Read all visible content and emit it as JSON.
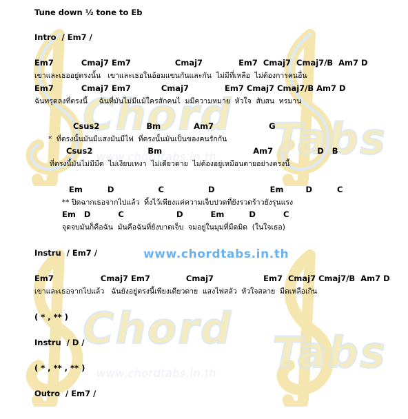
{
  "watermark": {
    "words": [
      "Chord",
      "Tabs",
      "Chord",
      "Tabs"
    ],
    "url": "www.chordtabs.in.th",
    "clef_icon": "treble-clef-icon"
  },
  "site_url": "www.chordtabs.in.th",
  "sheet": {
    "tuning": "Tune down ½ tone to Eb",
    "intro": "Intro  / Em7 /",
    "v1_chords_a": "Em7          Cmaj7 Em7                Cmaj7             Em7  Cmaj7  Cmaj7/B  Am7 D",
    "v1_lyrics_a": "เขาและเธออยู่ตรงนั้น   เขาและเธอในอ้อมแขนกันและกัน  ไม่มีที่เหลือ  ไม่ต้องการคนอื่น",
    "v1_chords_b": "Em7          Cmaj7 Em7           Cmaj7             Em7 Cmaj7 Cmaj7/B Am7 D",
    "v1_lyrics_b": "ฉันทรุดลงที่ตรงนี้     ฉันที่มันไม่มีแม้ใครสักคนไ  มมีความหมาย  หัวใจ  สับสน  ทรมาน",
    "pre_chords_a": "Csus2                 Bm            Am7                    G",
    "pre_lyrics_a": "*  ที่ตรงนั้นมันมีแสงมันมีไฟ  ที่ตรงนั้นมันเป็นของคนรักกัน",
    "pre_chords_b": "Csus2                    Bm                                 Am7                D   B",
    "pre_lyrics_b": "ที่ตรงนี้มันไม่มีมืด  ไม่เงียบเหงา  ไม่เดียวดาย  ไม่ต้องอยู่เหมือนตายอย่างตรงนี้",
    "ch_chords_a": "Em         D                C                D                    Em        D         C",
    "ch_lyrics_a": "** ปิดฉากเธอจากไปแล้ว  ทิ้งไว้เพียงแค่ความเจ็บปวดที่ยังรวดร้าวยังรุนแรง",
    "ch_chords_b": "Em   D          C                   D          Em         D          C",
    "ch_lyrics_b": "จุดจบมันก็คือฉัน  มันคือฉันที่ยังบาดเจ็บ  จมอยู่ในมุมที่มืดมิด  (ในใจเธอ)",
    "instru1": "Instru  / Em7 /",
    "v2_chords": "Em7                 Cmaj7 Em7             Cmaj7                  Em7  Cmaj7 Cmaj7/B  Am7 D",
    "v2_lyrics": "เขาและเธอจากไปแล้ว   ฉันยังอยู่ตรงนี้เพียงเดียวดาย  แสงไฟสลัว  หัวใจสลาย  มืดเหลือเกิน",
    "rep1": "( * , ** )",
    "instru2": "Instru  / D /",
    "rep2": "( * , ** , ** )",
    "outro": "Outro  / Em7 /"
  }
}
